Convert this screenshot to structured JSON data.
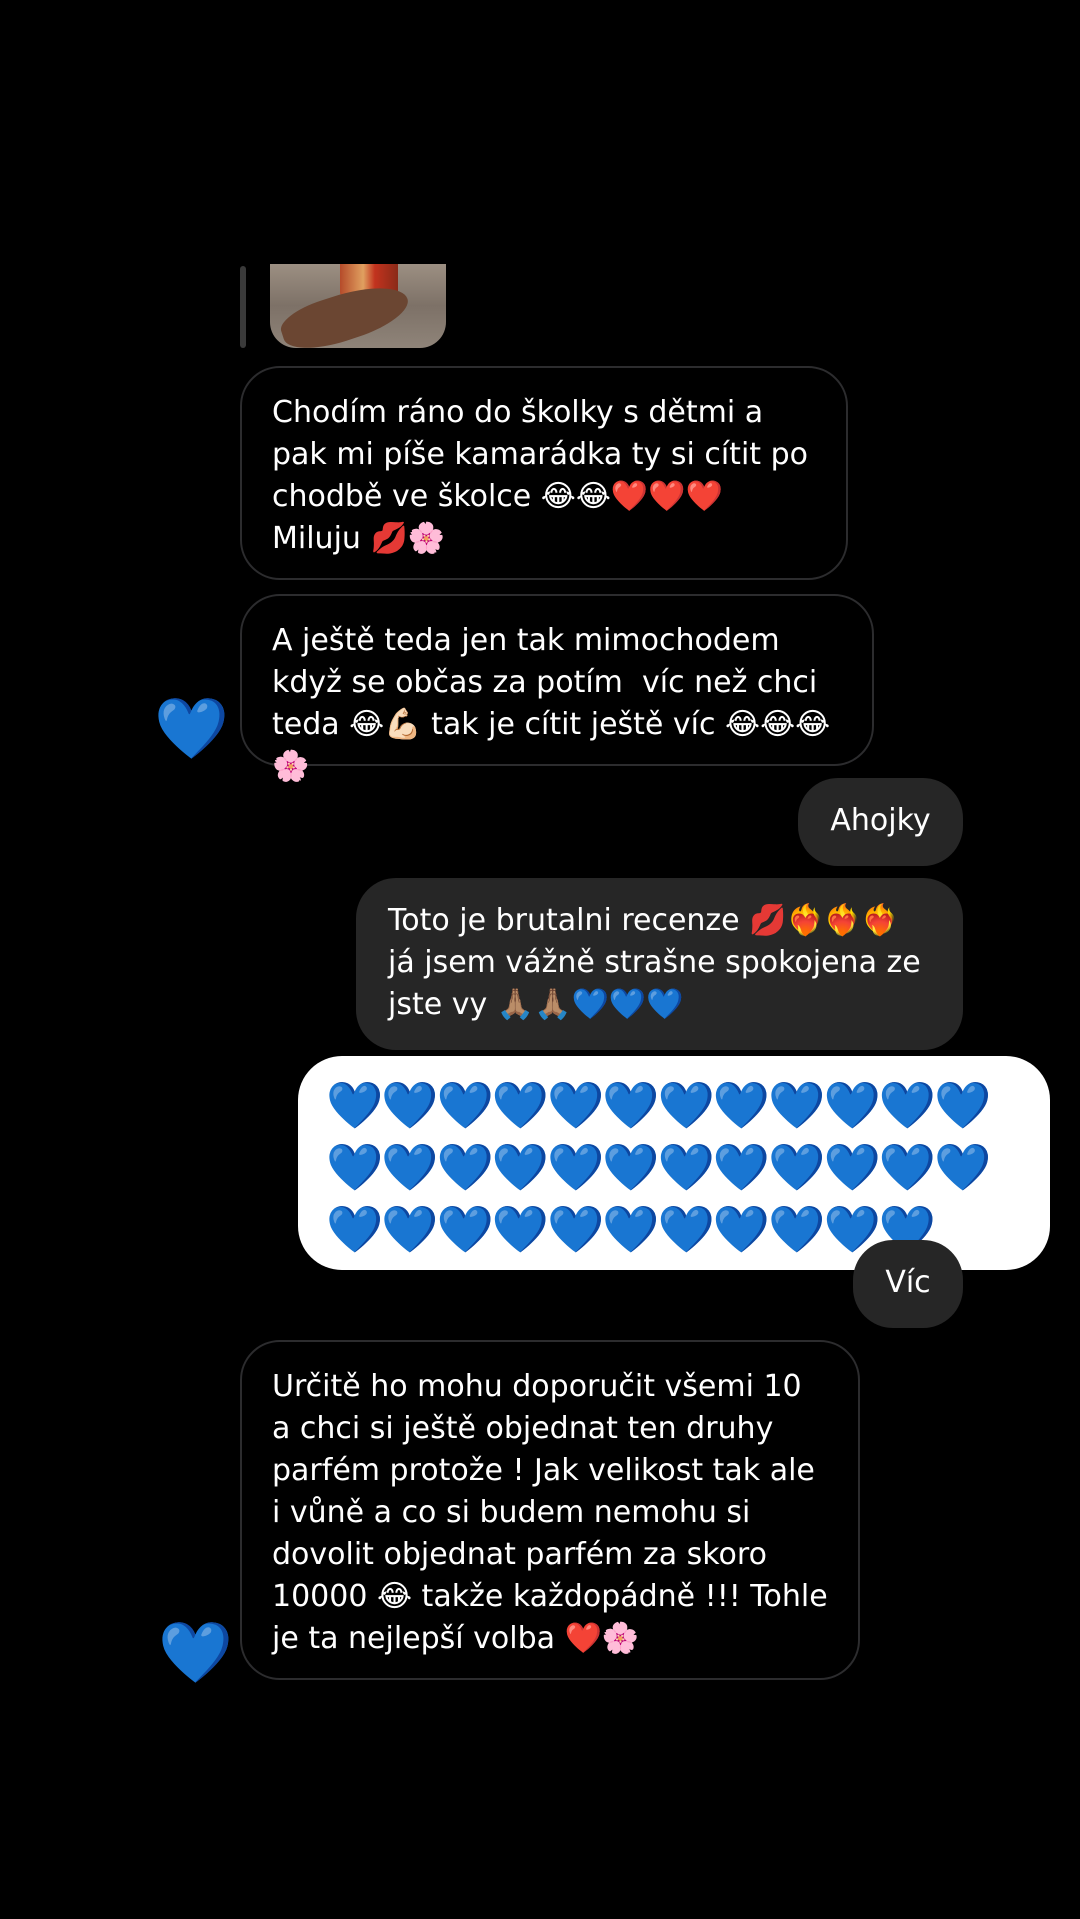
{
  "thread": {
    "messages": [
      {
        "side": "incoming",
        "text": "Chodím ráno do školky s dětmi a pak mi píše kamarádka ty si cítit po chodbě ve školce 😂😂❤️❤️❤️ Miluju 💋🌸"
      },
      {
        "side": "incoming",
        "text": "A ještě teda jen tak mimochodem když se občas za potím  víc než chci teda 😂💪🏻 tak je cítit ještě víc 😂😂😂🌸",
        "reaction": "💙"
      },
      {
        "side": "outgoing",
        "text": "Ahojky"
      },
      {
        "side": "outgoing",
        "text": "Toto je brutalni recenze 💋❤️‍🔥❤️‍🔥❤️‍🔥 já jsem vážně strašne spokojena ze jste vy 🙏🏽🙏🏽💙💙💙"
      },
      {
        "side": "outgoing",
        "text": "💙💙💙💙💙💙💙💙💙💙💙💙💙💙💙💙💙💙💙💙💙💙💙💙💙💙💙💙💙💙💙💙💙💙💙"
      },
      {
        "side": "outgoing",
        "text": "Víc"
      },
      {
        "side": "incoming",
        "text": "Určitě ho mohu doporučit všemi 10  a chci si ještě objednat ten druhy parfém protože ! Jak velikost tak ale i vůně a co si budem nemohu si dovolit objednat parfém za skoro 10000 😂 takže každopádně !!! Tohle je ta nejlepší volba ❤️🌸",
        "reaction": "💙"
      }
    ]
  },
  "colors": {
    "background": "#000000",
    "outgoing_bubble": "#262626",
    "incoming_border": "#2c2c2e",
    "emoji_bubble": "#ffffff",
    "reaction_heart": "#1d7cf2"
  }
}
